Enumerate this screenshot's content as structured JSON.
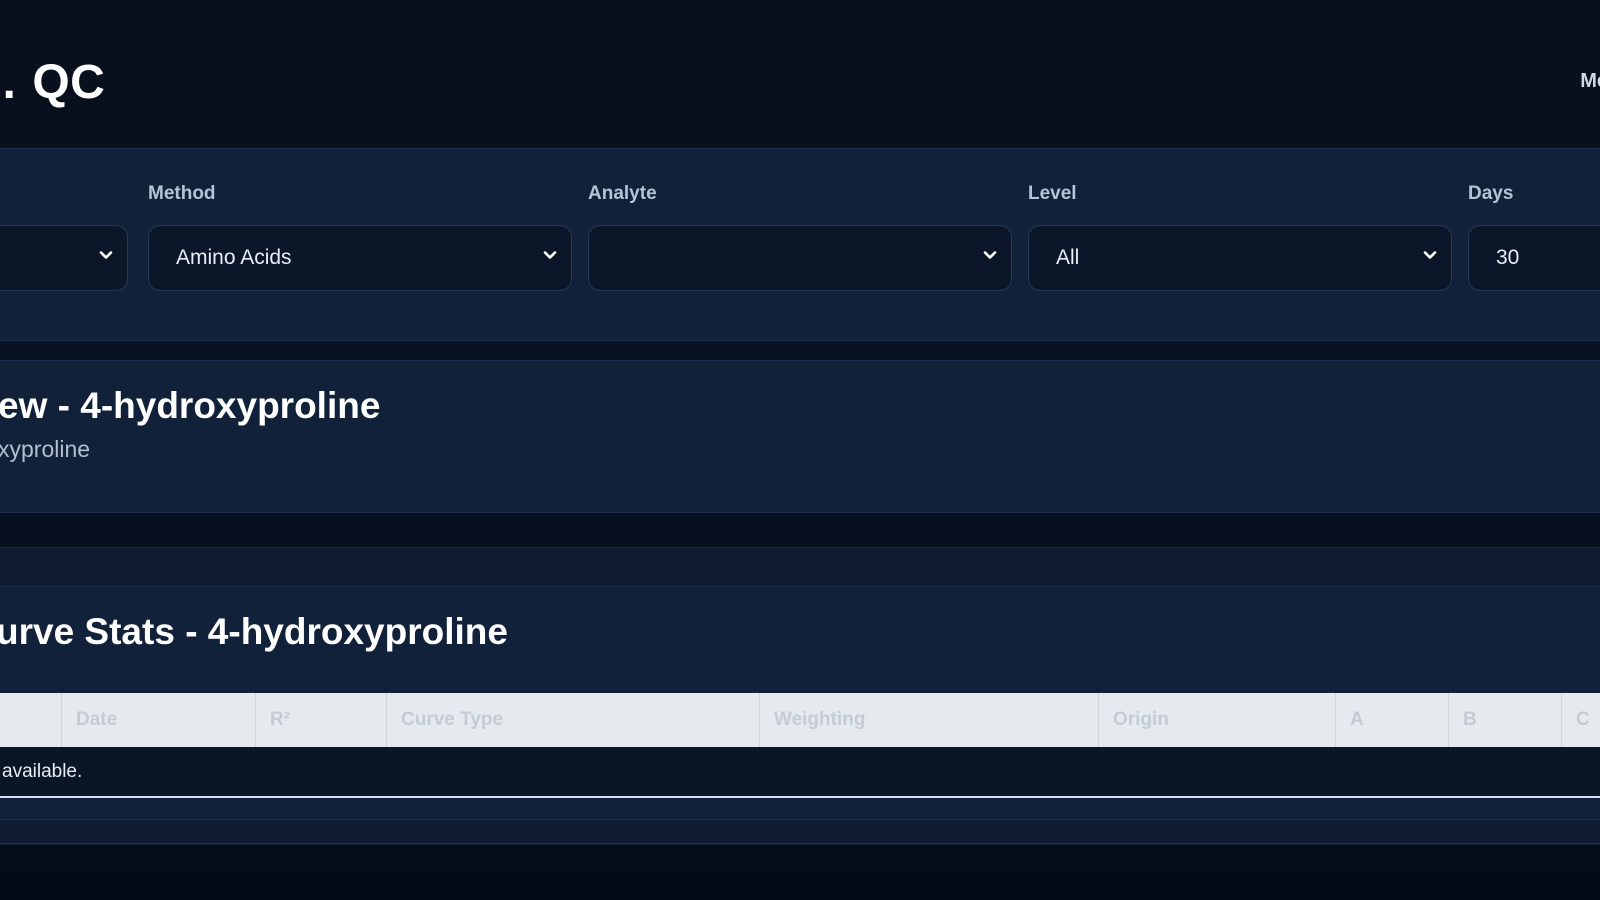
{
  "header": {
    "title": "QC",
    "title_fragment": "…",
    "nav_fragment": "Mc"
  },
  "filters": {
    "first": {
      "value": ""
    },
    "method": {
      "label": "Method",
      "value": "Amino Acids"
    },
    "analyte": {
      "label": "Analyte",
      "value": ""
    },
    "level": {
      "label": "Level",
      "value": "All"
    },
    "days": {
      "label": "Days",
      "value": "30"
    }
  },
  "overview": {
    "title": "ew - 4-hydroxyproline",
    "subtitle": "xyproline"
  },
  "curve_stats": {
    "title": "urve Stats - 4-hydroxyproline",
    "columns": [
      "Date",
      "R²",
      "Curve Type",
      "Weighting",
      "Origin",
      "A",
      "B",
      "C"
    ],
    "empty_message": "available."
  }
}
